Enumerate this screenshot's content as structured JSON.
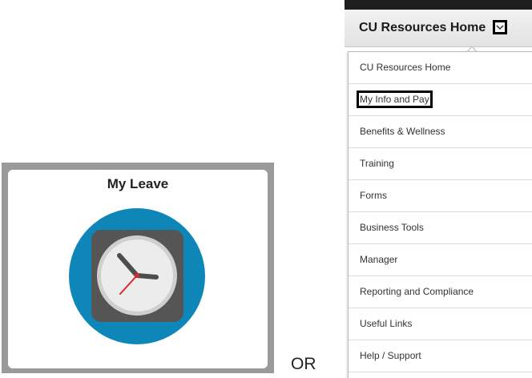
{
  "tile": {
    "title": "My Leave",
    "icon": "clock-icon",
    "colors": {
      "circle": "#0f86b8",
      "square": "#555555",
      "face": "#e8e8e8"
    }
  },
  "separator": {
    "text": "OR"
  },
  "menu": {
    "header_title": "CU Resources Home",
    "chevron": "chevron-down-icon",
    "items": [
      {
        "label": "CU Resources Home",
        "highlighted": false
      },
      {
        "label": "My Info and Pay",
        "highlighted": true
      },
      {
        "label": "Benefits & Wellness",
        "highlighted": false
      },
      {
        "label": "Training",
        "highlighted": false
      },
      {
        "label": "Forms",
        "highlighted": false
      },
      {
        "label": "Business Tools",
        "highlighted": false
      },
      {
        "label": "Manager",
        "highlighted": false
      },
      {
        "label": "Reporting and Compliance",
        "highlighted": false
      },
      {
        "label": "Useful Links",
        "highlighted": false
      },
      {
        "label": "Help / Support",
        "highlighted": false
      }
    ]
  }
}
